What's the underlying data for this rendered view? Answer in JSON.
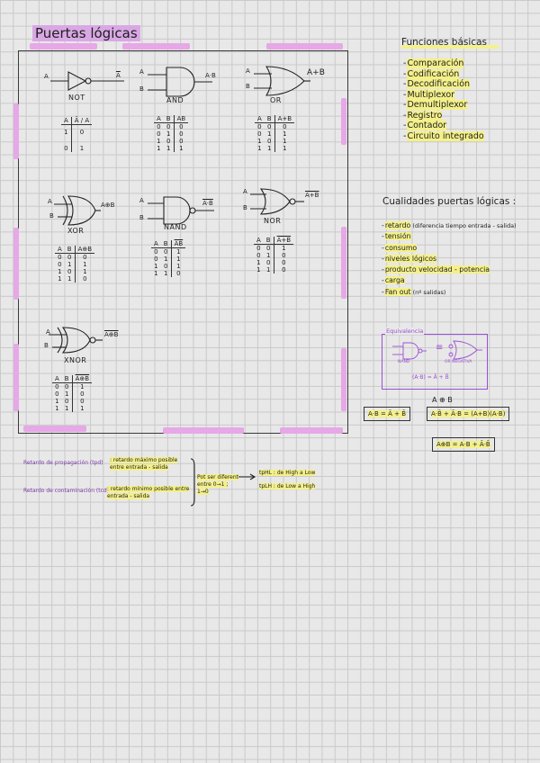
{
  "title": "Puertas lógicas",
  "gates": [
    {
      "id": "not",
      "label": "NOT",
      "in_a": "A",
      "in_b": "",
      "out": "Ā",
      "table": {
        "headers": [
          "A",
          "Ā / A"
        ],
        "rows": [
          [
            "1",
            "0"
          ],
          [
            "0",
            "1"
          ]
        ]
      }
    },
    {
      "id": "and",
      "label": "AND",
      "in_a": "A",
      "in_b": "B",
      "out": "A·B",
      "table": {
        "headers": [
          "A",
          "B",
          "AB"
        ],
        "rows": [
          [
            "0",
            "0",
            "0"
          ],
          [
            "0",
            "1",
            "0"
          ],
          [
            "1",
            "0",
            "0"
          ],
          [
            "1",
            "1",
            "1"
          ]
        ]
      }
    },
    {
      "id": "or",
      "label": "OR",
      "in_a": "A",
      "in_b": "B",
      "out": "A+B",
      "table": {
        "headers": [
          "A",
          "B",
          "A+B"
        ],
        "rows": [
          [
            "0",
            "0",
            "0"
          ],
          [
            "0",
            "1",
            "1"
          ],
          [
            "1",
            "0",
            "1"
          ],
          [
            "1",
            "1",
            "1"
          ]
        ]
      }
    },
    {
      "id": "xor",
      "label": "XOR",
      "in_a": "A",
      "in_b": "B",
      "out": "A⊕B",
      "table": {
        "headers": [
          "A",
          "B",
          "A⊕B"
        ],
        "rows": [
          [
            "0",
            "0",
            "0"
          ],
          [
            "0",
            "1",
            "1"
          ],
          [
            "1",
            "0",
            "1"
          ],
          [
            "1",
            "1",
            "0"
          ]
        ]
      }
    },
    {
      "id": "nand",
      "label": "NAND",
      "in_a": "A",
      "in_b": "B",
      "out": "A·B",
      "table": {
        "headers": [
          "A",
          "B",
          "AB"
        ],
        "rows": [
          [
            "0",
            "0",
            "1"
          ],
          [
            "0",
            "1",
            "1"
          ],
          [
            "1",
            "0",
            "1"
          ],
          [
            "1",
            "1",
            "0"
          ]
        ]
      }
    },
    {
      "id": "nor",
      "label": "NOR",
      "in_a": "A",
      "in_b": "B",
      "out": "A+B",
      "table": {
        "headers": [
          "A",
          "B",
          "A+B"
        ],
        "rows": [
          [
            "0",
            "0",
            "1"
          ],
          [
            "0",
            "1",
            "0"
          ],
          [
            "1",
            "0",
            "0"
          ],
          [
            "1",
            "1",
            "0"
          ]
        ]
      }
    },
    {
      "id": "xnor",
      "label": "XNOR",
      "in_a": "A",
      "in_b": "B",
      "out": "A⊕B",
      "table": {
        "headers": [
          "A",
          "B",
          "A⊕B"
        ],
        "rows": [
          [
            "0",
            "0",
            "1"
          ],
          [
            "0",
            "1",
            "0"
          ],
          [
            "1",
            "0",
            "0"
          ],
          [
            "1",
            "1",
            "1"
          ]
        ]
      }
    }
  ],
  "basic_functions": {
    "title": "Funciones básicas",
    "items": [
      "Comparación",
      "Codificación",
      "Decodificación",
      "Multiplexor",
      "Demultiplexor",
      "Registro",
      "Contador",
      "Circuito integrado"
    ]
  },
  "qualities": {
    "title": "Cualidades puertas lógicas :",
    "items": [
      {
        "main": "retardo",
        "extra": " (diferencia tiempo entrada - salida)"
      },
      {
        "main": "tensión",
        "extra": ""
      },
      {
        "main": "consumo",
        "extra": ""
      },
      {
        "main": "niveles lógicos",
        "extra": ""
      },
      {
        "main": "producto velocidad - potencia",
        "extra": ""
      },
      {
        "main": "carga",
        "extra": ""
      },
      {
        "main": "Fan out",
        "extra": " (nº salidas)"
      }
    ]
  },
  "equivalence": {
    "title": "Equivalencia",
    "left_label": "NAND",
    "right_label": "OR NEGATIVA",
    "equal_sign": "≡",
    "formula": "(A·B) = Ā + B̄"
  },
  "identities": {
    "xor_title": "A ⊕ B",
    "xor_expr": "A·B̄ + Ā·B = (A+B)(A·B)",
    "nand_expr": "A·B = Ā + B̄",
    "xnor_expr": "A⊕B = A·B + Ā·B̄"
  },
  "delays": {
    "tpd_label": "Retardo de propagación (tpd)",
    "tpd_text": ": retardo máximo posible entre entrada - salida",
    "tcd_label": "Retardo de contaminación (tcd)",
    "tcd_text": ": retardo mínimo posible entre entrada - salida",
    "middle": "Pot ser diferent entre 0→1 ; 1→0",
    "tphl": "tpHL : de High a Low",
    "tplh": "tpLH : de Low a High"
  },
  "colors": {
    "purple_highlight": "#d9a8e4",
    "yellow_highlight": "#f4f08a",
    "frame_pink": "#e6a8e6",
    "equiv_border": "#9a4fd6"
  }
}
